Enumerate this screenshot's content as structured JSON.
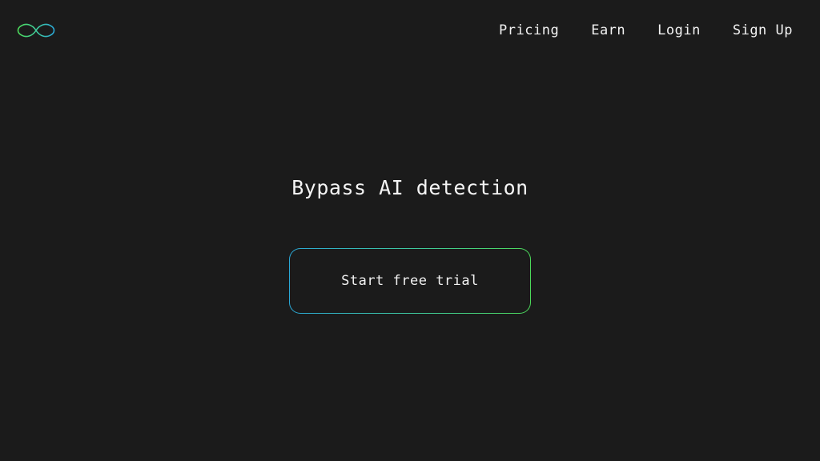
{
  "header": {
    "logo_icon": "infinity-icon",
    "nav": [
      {
        "label": "Pricing"
      },
      {
        "label": "Earn"
      },
      {
        "label": "Login"
      },
      {
        "label": "Sign Up"
      }
    ]
  },
  "hero": {
    "title": "Bypass AI detection",
    "cta_label": "Start free trial"
  },
  "colors": {
    "background": "#1b1b1b",
    "text": "#f2f2f2",
    "accent_start": "#2aa7d6",
    "accent_end": "#4cd95a"
  }
}
